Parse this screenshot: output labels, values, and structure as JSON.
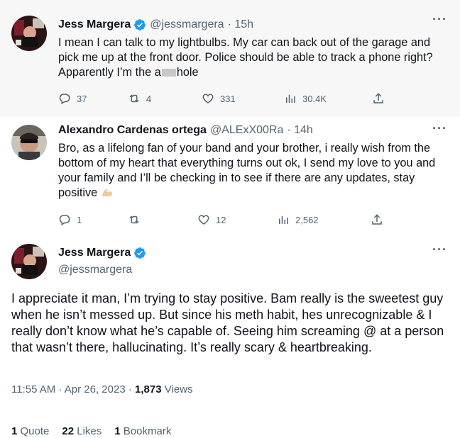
{
  "colors": {
    "verified": "#1d9bf0",
    "text": "#0f1419",
    "secondary": "#536471",
    "thread_line": "#cfd9de"
  },
  "tweets": [
    {
      "name": "Jess Margera",
      "handle": "@jessmargera",
      "time": "· 15h",
      "more": "···",
      "text_before_redaction": "I mean I can talk to my lightbulbs. My car can back out of the garage and pick me up at the front door. Police should be able to track a phone right? Apparently I’m the a",
      "text_after_redaction": "hole",
      "replies": "37",
      "reposts": "4",
      "likes": "331",
      "views": "30.4K"
    },
    {
      "name": "Alexandro Cardenas ortega",
      "handle": "@ALExX00Ra",
      "time": "· 14h",
      "more": "···",
      "text": "Bro, as a lifelong fan of your band and your brother, i really wish from the bottom of my heart that everything turns out ok, I send my love to you and your family and I’ll be checking in to see if there are any updates, stay positive",
      "emoji": "flexed-biceps",
      "replies": "1",
      "reposts": "",
      "likes": "12",
      "views": "2,562"
    }
  ],
  "main_tweet": {
    "name": "Jess Margera",
    "handle": "@jessmargera",
    "more": "···",
    "text": "I appreciate it man, I’m trying to stay positive. Bam really is the sweetest guy when he isn’t messed up. But since his meth habit, hes unrecognizable & I really don’t know what he’s capable of. Seeing him screaming @ at a person that wasn’t there, hallucinating. It’s really scary & heartbreaking.",
    "time": "11:55 AM",
    "date": "Apr 26, 2023",
    "sep": "·",
    "views_count": "1,873",
    "views_label": "Views",
    "quotes_count": "1",
    "quotes_label": "Quote",
    "likes_count": "22",
    "likes_label": "Likes",
    "bookmarks_count": "1",
    "bookmarks_label": "Bookmark"
  },
  "icons": {
    "reply": "reply-icon",
    "repost": "repost-icon",
    "like": "heart-icon",
    "views": "analytics-icon",
    "share": "share-icon",
    "verified": "verified-badge-icon"
  }
}
